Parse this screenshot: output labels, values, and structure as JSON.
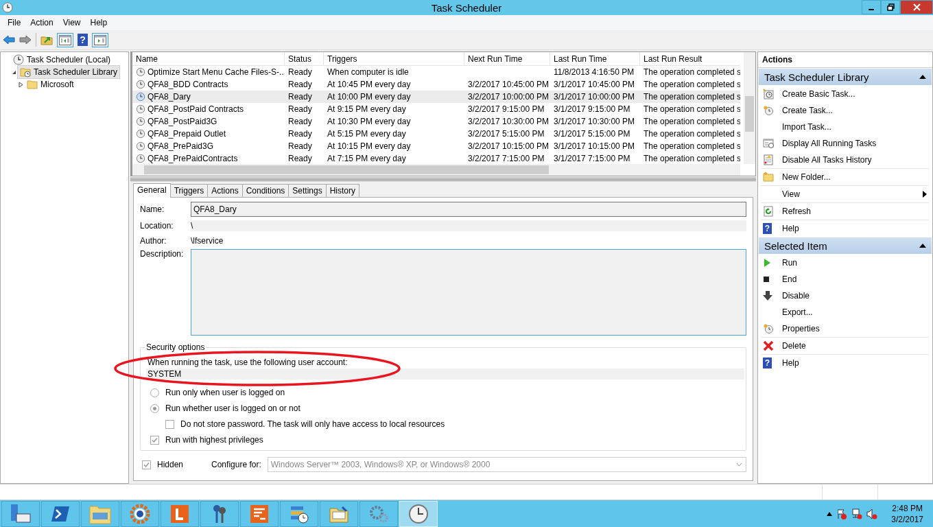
{
  "window": {
    "title": "Task Scheduler"
  },
  "menu": [
    "File",
    "Action",
    "View",
    "Help"
  ],
  "toolbar": {
    "help_glyph": "?"
  },
  "tree": [
    {
      "label": "Task Scheduler (Local)",
      "selected": false,
      "children": [
        {
          "label": "Task Scheduler Library",
          "selected": true,
          "expanded": true,
          "children": [
            {
              "label": "Microsoft",
              "selected": false,
              "expanded": false
            }
          ]
        }
      ]
    }
  ],
  "tasks": {
    "columns": [
      "Name",
      "Status",
      "Triggers",
      "Next Run Time",
      "Last Run Time",
      "Last Run Result"
    ],
    "rows": [
      {
        "selected": false,
        "cells": [
          "Optimize Start Menu Cache Files-S-...",
          "Ready",
          "When computer is idle",
          "",
          "11/8/2013 4:16:50 PM",
          "The operation completed s"
        ]
      },
      {
        "selected": false,
        "cells": [
          "QFA8_BDD Contracts",
          "Ready",
          "At 10:45 PM every day",
          "3/2/2017 10:45:00 PM",
          "3/1/2017 10:45:00 PM",
          "The operation completed s"
        ]
      },
      {
        "selected": true,
        "cells": [
          "QFA8_Dary",
          "Ready",
          "At 10:00 PM every day",
          "3/2/2017 10:00:00 PM",
          "3/1/2017 10:00:00 PM",
          "The operation completed s"
        ]
      },
      {
        "selected": false,
        "cells": [
          "QFA8_PostPaid Contracts",
          "Ready",
          "At 9:15 PM every day",
          "3/2/2017 9:15:00 PM",
          "3/1/2017 9:15:00 PM",
          "The operation completed s"
        ]
      },
      {
        "selected": false,
        "cells": [
          "QFA8_PostPaid3G",
          "Ready",
          "At 10:30 PM every day",
          "3/2/2017 10:30:00 PM",
          "3/1/2017 10:30:00 PM",
          "The operation completed s"
        ]
      },
      {
        "selected": false,
        "cells": [
          "QFA8_Prepaid Outlet",
          "Ready",
          "At 5:15 PM every day",
          "3/2/2017 5:15:00 PM",
          "3/1/2017 5:15:00 PM",
          "The operation completed s"
        ]
      },
      {
        "selected": false,
        "cells": [
          "QFA8_PrePaid3G",
          "Ready",
          "At 10:15 PM every day",
          "3/2/2017 10:15:00 PM",
          "3/1/2017 10:15:00 PM",
          "The operation completed s"
        ]
      },
      {
        "selected": false,
        "cells": [
          "QFA8_PrePaidContracts",
          "Ready",
          "At 7:15 PM every day",
          "3/2/2017 7:15:00 PM",
          "3/1/2017 7:15:00 PM",
          "The operation completed s"
        ]
      }
    ]
  },
  "tabs": [
    {
      "label": "General",
      "selected": true
    },
    {
      "label": "Triggers",
      "selected": false
    },
    {
      "label": "Actions",
      "selected": false
    },
    {
      "label": "Conditions",
      "selected": false
    },
    {
      "label": "Settings",
      "selected": false
    },
    {
      "label": "History",
      "selected": false
    }
  ],
  "general": {
    "name_label": "Name:",
    "name": "QFA8_Dary",
    "location_label": "Location:",
    "location": "\\",
    "author_label": "Author:",
    "author": "\\lfservice",
    "description_label": "Description:"
  },
  "security": {
    "legend": "Security options",
    "prompt": "When running the task, use the following user account:",
    "account": "SYSTEM",
    "options": [
      {
        "kind": "radio",
        "label": "Run only when user is logged on",
        "selected": false
      },
      {
        "kind": "radio",
        "label": "Run whether user is logged on or not",
        "selected": true,
        "children": [
          {
            "kind": "checkbox",
            "label": "Do not store password.  The task will only have access to local resources",
            "checked": false
          }
        ]
      },
      {
        "kind": "checkbox",
        "label": "Run with highest privileges",
        "checked": true
      }
    ]
  },
  "hidden": {
    "label": "Hidden",
    "checked": true
  },
  "configure": {
    "label": "Configure for:",
    "value": "Windows Server™ 2003, Windows® XP, or Windows® 2000"
  },
  "annotations": [
    {
      "kind": "ellipse",
      "color": "#e8141e"
    }
  ],
  "actions": {
    "title": "Actions",
    "sections": [
      {
        "title": "Task Scheduler Library",
        "expanded": true,
        "items": [
          {
            "label": "Create Basic Task...",
            "kind": "wizard",
            "divider": false
          },
          {
            "label": "Create Task...",
            "kind": "task",
            "divider": false
          },
          {
            "label": "Import Task...",
            "kind": "plain",
            "divider": false
          },
          {
            "label": "Display All Running Tasks",
            "kind": "list",
            "divider": false
          },
          {
            "label": "Disable All Tasks History",
            "kind": "log",
            "divider": true
          },
          {
            "label": "New Folder...",
            "kind": "folder",
            "divider": true
          },
          {
            "label": "View",
            "kind": "plain",
            "submenu": true,
            "divider": true
          },
          {
            "label": "Refresh",
            "kind": "refresh",
            "divider": true
          },
          {
            "label": "Help",
            "kind": "help",
            "glyph": "?",
            "divider": false
          }
        ]
      },
      {
        "title": "Selected Item",
        "expanded": true,
        "items": [
          {
            "label": "Run",
            "kind": "run",
            "divider": false
          },
          {
            "label": "End",
            "kind": "end",
            "divider": false
          },
          {
            "label": "Disable",
            "kind": "down",
            "divider": false
          },
          {
            "label": "Export...",
            "kind": "plain",
            "divider": false
          },
          {
            "label": "Properties",
            "kind": "task",
            "divider": true
          },
          {
            "label": "Delete",
            "kind": "delete",
            "divider": true
          },
          {
            "label": "Help",
            "kind": "help",
            "glyph": "?",
            "divider": false
          }
        ]
      }
    ]
  },
  "taskbar": [
    {
      "kind": "server",
      "selected": false
    },
    {
      "kind": "shell",
      "selected": false
    },
    {
      "kind": "explorer",
      "selected": false
    },
    {
      "kind": "gear",
      "selected": false
    },
    {
      "kind": "letter",
      "selected": false
    },
    {
      "kind": "keys",
      "selected": false
    },
    {
      "kind": "doc",
      "selected": false
    },
    {
      "kind": "stack",
      "selected": false
    },
    {
      "kind": "folderpen",
      "selected": false
    },
    {
      "kind": "gears",
      "selected": false
    },
    {
      "kind": "clock",
      "selected": true
    }
  ],
  "tray": {
    "time": "2:48 PM",
    "date": "3/2/2017"
  }
}
